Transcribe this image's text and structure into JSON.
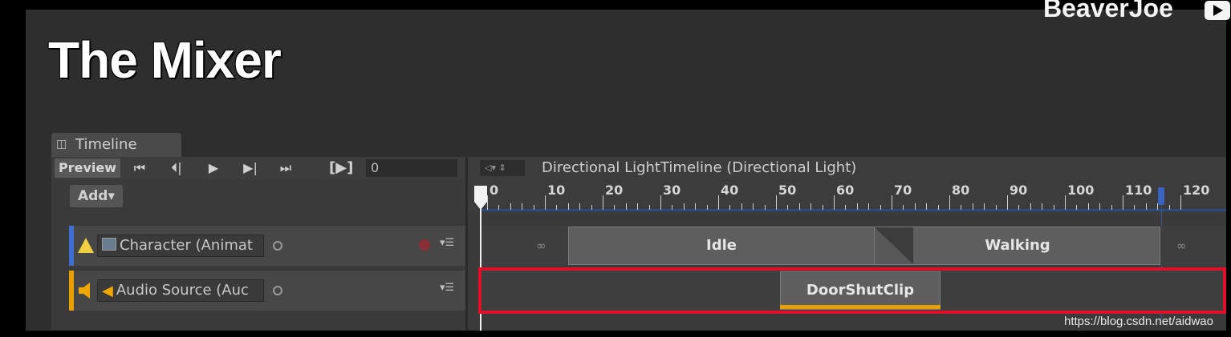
{
  "slide": {
    "title": "The Mixer",
    "brand": "BeaverJoe"
  },
  "timeline_window": {
    "tab_label": "Timeline",
    "toolbar": {
      "preview_label": "Preview",
      "frame_box_label": "[▶]",
      "frame_value": "0",
      "timeline_name": "Directional LightTimeline (Directional Light)"
    },
    "add_button_label": "Add▾",
    "ruler_labels": [
      "0",
      "10",
      "20",
      "30",
      "40",
      "50",
      "60",
      "70",
      "80",
      "90",
      "100",
      "110",
      "120"
    ],
    "tracks": [
      {
        "name": "Character (Animat",
        "type": "animation",
        "color": "#3f6fd1",
        "icon": "warning-triangle-icon",
        "clips": [
          {
            "label": "Idle",
            "start": 15,
            "end": 68
          },
          {
            "label": "Walking",
            "start": 68,
            "end": 118
          }
        ],
        "blend": {
          "start": 68,
          "end": 74
        }
      },
      {
        "name": "Audio Source (Auc",
        "type": "audio",
        "color": "#e8a000",
        "icon": "speaker-icon",
        "clips": [
          {
            "label": "DoorShutClip",
            "start": 52,
            "end": 80
          }
        ]
      }
    ]
  },
  "colors": {
    "highlight": "#e0102a",
    "audio": "#e8a000",
    "animation": "#3f6fd1"
  },
  "watermark": "https://blog.csdn.net/aidwao"
}
